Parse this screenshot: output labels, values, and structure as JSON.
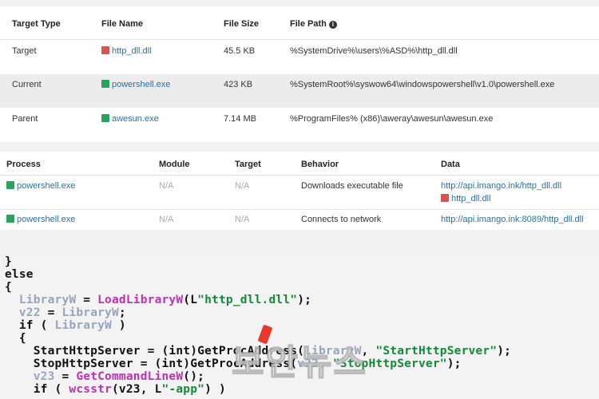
{
  "files_table": {
    "headers": [
      "Target Type",
      "File Name",
      "File Size",
      "File Path"
    ],
    "rows": [
      {
        "type": "Target",
        "name": "http_dll.dll",
        "icon": "red-square-icon",
        "size": "45.5 KB",
        "path": "%SystemDrive%\\users\\%ASD%\\http_dll.dll"
      },
      {
        "type": "Current",
        "name": "powershell.exe",
        "icon": "green-square-icon",
        "size": "423 KB",
        "path": "%SystemRoot%\\syswow64\\windowspowershell\\v1.0\\powershell.exe"
      },
      {
        "type": "Parent",
        "name": "awesun.exe",
        "icon": "green-square-icon",
        "size": "7.14 MB",
        "path": "%ProgramFiles% (x86)\\aweray\\awesun\\awesun.exe"
      }
    ]
  },
  "behavior_table": {
    "headers": [
      "Process",
      "Module",
      "Target",
      "Behavior",
      "Data"
    ],
    "rows": [
      {
        "process": "powershell.exe",
        "module": "N/A",
        "target": "N/A",
        "behavior": "Downloads executable file",
        "data": "http://api.imango.ink/http_dll.dll",
        "data2": "http_dll.dll"
      },
      {
        "process": "powershell.exe",
        "module": "N/A",
        "target": "N/A",
        "behavior": "Connects to network",
        "data": "http://api.imango.ink:8089/http_dll.dll"
      }
    ]
  },
  "code": {
    "l1": "}",
    "l2": "else",
    "l3": "{",
    "l4_var": "LibraryW",
    "l4_eq": " = ",
    "l4_fn": "LoadLibraryW",
    "l4_open": "(L",
    "l4_str": "\"http_dll.dll\"",
    "l4_close": ");",
    "l5_var": "v22",
    "l5_eq": " = ",
    "l5_var2": "LibraryW",
    "l5_end": ";",
    "l6_kw": "if",
    "l6_open": " ( ",
    "l6_var": "LibraryW",
    "l6_close": " )",
    "l7": "{",
    "l8_var": "StartHttpServer",
    "l8_mid": " = (int)GetProcAddress(",
    "l8_var2": "LibraryW",
    "l8_comma": ", ",
    "l8_str": "\"StartHttpServer\"",
    "l8_end": ");",
    "l9_var": "StopHttpServer",
    "l9_mid": " = (int)GetProcAddress(",
    "l9_var2": "v22",
    "l9_comma": ", ",
    "l9_str": "\"StopHttpServer\"",
    "l9_end": ");",
    "l10_var": "v23",
    "l10_eq": " = ",
    "l10_fn": "GetCommandLineW",
    "l10_end": "();",
    "l11_kw": "if",
    "l11_open": " ( ",
    "l11_fn": "wcsstr",
    "l11_args": "(v23, L",
    "l11_str": "\"-app\"",
    "l11_end": ") )"
  },
  "watermark": "보안뉴스",
  "colors": {
    "accent_link": "#2f6e9e",
    "red": "#d9534f",
    "green": "#29a35a",
    "highlight_row": "#ececec"
  }
}
